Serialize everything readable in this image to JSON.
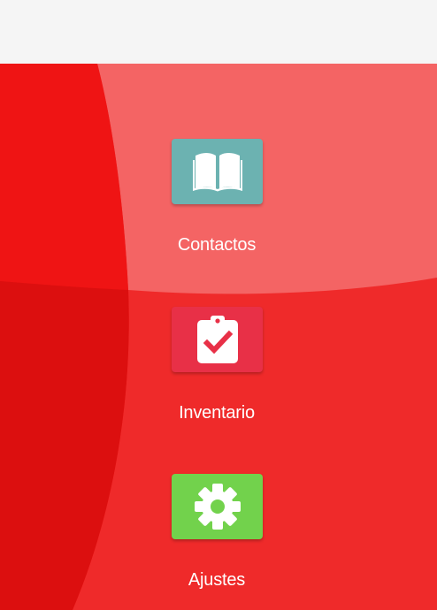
{
  "colors": {
    "top_bar": "#f5f5f5",
    "bg_left": "#ef1414",
    "bg_left_lower": "#dc0f0f",
    "bg_upper_right": "#f46464",
    "bg_lower_right": "#ef2a2a",
    "contactos_tile": "#6cb2b1",
    "inventario_tile": "#e83047",
    "ajustes_tile": "#72d24c",
    "label_text": "#ffffff"
  },
  "menu": {
    "items": [
      {
        "id": "contactos",
        "label": "Contactos",
        "icon": "book-open-icon"
      },
      {
        "id": "inventario",
        "label": "Inventario",
        "icon": "clipboard-check-icon"
      },
      {
        "id": "ajustes",
        "label": "Ajustes",
        "icon": "gear-icon"
      }
    ]
  }
}
